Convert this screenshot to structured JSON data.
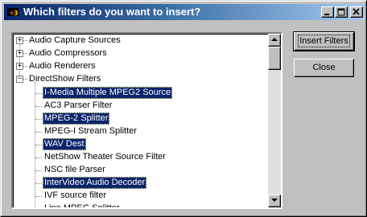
{
  "window": {
    "title": "Which filters do you want to insert?",
    "controls": {
      "minimize_icon": "minimize-icon",
      "maximize_icon": "maximize-icon",
      "close_icon": "close-icon"
    }
  },
  "tree": {
    "items": [
      {
        "label": "Audio Capture Sources",
        "expander": "+",
        "selected": false
      },
      {
        "label": "Audio Compressors",
        "expander": "+",
        "selected": false
      },
      {
        "label": "Audio Renderers",
        "expander": "+",
        "selected": false
      },
      {
        "label": "DirectShow Filters",
        "expander": "−",
        "selected": false
      },
      {
        "label": "I-Media Multiple MPEG2 Source",
        "selected": true
      },
      {
        "label": "AC3 Parser Filter",
        "selected": false
      },
      {
        "label": "MPEG-2 Splitter",
        "selected": true
      },
      {
        "label": "MPEG-I Stream Splitter",
        "selected": false
      },
      {
        "label": "WAV Dest",
        "selected": true
      },
      {
        "label": "NetShow Theater Source Filter",
        "selected": false
      },
      {
        "label": "NSC file Parser",
        "selected": false
      },
      {
        "label": "InterVideo Audio Decoder",
        "selected": true
      },
      {
        "label": "IVF source filter",
        "selected": false
      },
      {
        "label": "Line MPEG Splitter",
        "selected": false
      }
    ]
  },
  "buttons": {
    "insert": "Insert Filters",
    "close": "Close"
  },
  "colors": {
    "selection": "#0a246a",
    "face": "#c0c0c0",
    "title_start": "#0a246a",
    "title_end": "#a6caf0"
  }
}
